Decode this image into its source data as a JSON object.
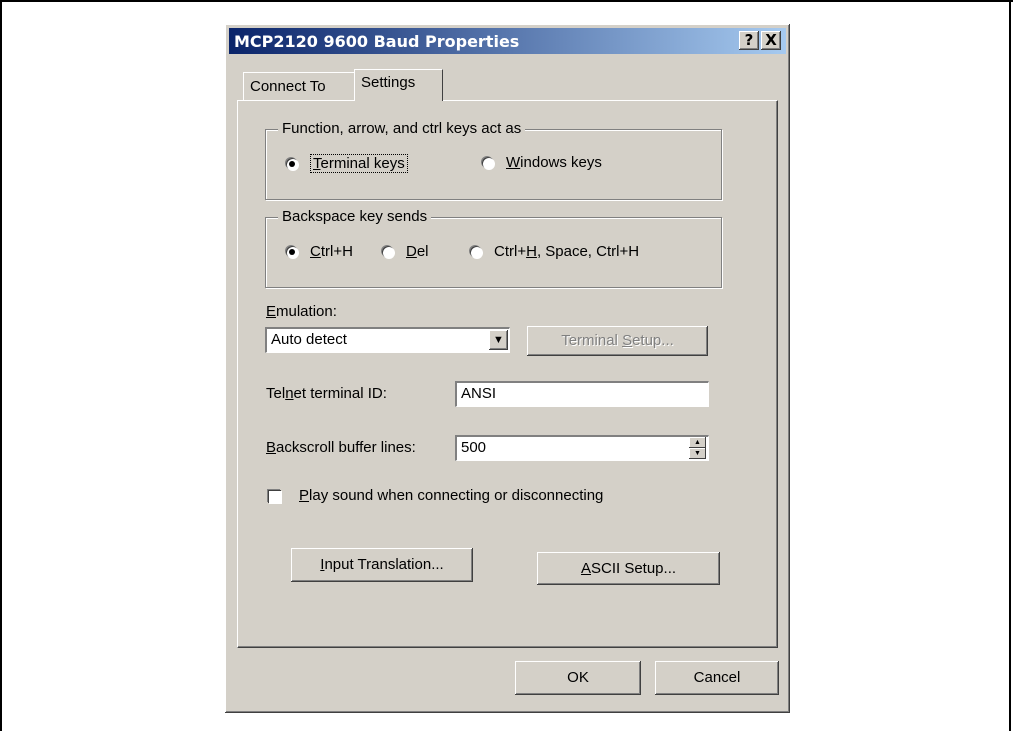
{
  "window": {
    "title": "MCP2120 9600 Baud Properties",
    "help_button": "?",
    "close_button": "X"
  },
  "tabs": [
    {
      "label": "Connect To",
      "active": false
    },
    {
      "label": "Settings",
      "active": true
    }
  ],
  "keys_group": {
    "title": "Function, arrow, and ctrl keys act as",
    "options": [
      {
        "mnemonic": "T",
        "rest": "erminal keys",
        "checked": true
      },
      {
        "mnemonic": "W",
        "rest": "indows keys",
        "checked": false
      }
    ]
  },
  "backspace_group": {
    "title": "Backspace key sends",
    "options": [
      {
        "mnemonic": "C",
        "rest": "trl+H",
        "checked": true
      },
      {
        "mnemonic": "D",
        "rest": "el",
        "checked": false
      },
      {
        "pre": "Ctrl+",
        "mnemonic": "H",
        "rest": ", Space, Ctrl+H",
        "checked": false
      }
    ]
  },
  "emulation": {
    "label_mnemonic": "E",
    "label_rest": "mulation:",
    "value": "Auto detect",
    "setup_pre": "Terminal ",
    "setup_mnemonic": "S",
    "setup_rest": "etup..."
  },
  "telnet": {
    "label_pre": "Tel",
    "label_mnemonic": "n",
    "label_rest": "et terminal ID:",
    "value": "ANSI"
  },
  "backscroll": {
    "label_mnemonic": "B",
    "label_rest": "ackscroll buffer lines:",
    "value": "500"
  },
  "play_sound": {
    "mnemonic": "P",
    "rest": "lay sound when connecting or disconnecting",
    "checked": false
  },
  "buttons": {
    "input_translation_mnemonic": "I",
    "input_translation_rest": "nput Translation...",
    "ascii_mnemonic": "A",
    "ascii_rest": "SCII Setup...",
    "ok": "OK",
    "cancel": "Cancel"
  }
}
